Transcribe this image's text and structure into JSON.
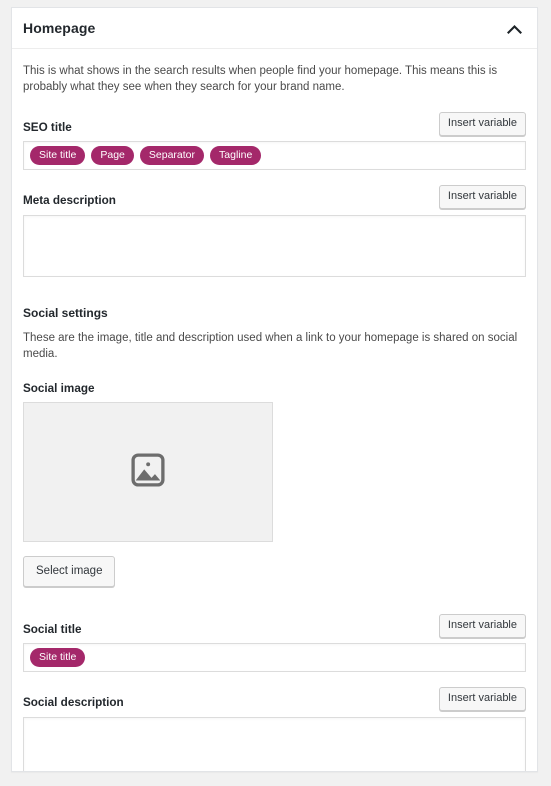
{
  "panel": {
    "title": "Homepage",
    "collapse_icon": "chevron-up-icon",
    "intro": "This is what shows in the search results when people find your homepage. This means this is probably what they see when they search for your brand name."
  },
  "seo_title": {
    "label": "SEO title",
    "insert_variable_label": "Insert variable",
    "pills": [
      {
        "label": "Site title"
      },
      {
        "label": "Page"
      },
      {
        "label": "Separator"
      },
      {
        "label": "Tagline"
      }
    ]
  },
  "meta_description": {
    "label": "Meta description",
    "insert_variable_label": "Insert variable",
    "value": "",
    "placeholder": ""
  },
  "social_settings": {
    "heading": "Social settings",
    "description": "These are the image, title and description used when a link to your homepage is shared on social media."
  },
  "social_image": {
    "label": "Social image",
    "placeholder_icon": "image-placeholder-icon",
    "select_button_label": "Select image"
  },
  "social_title": {
    "label": "Social title",
    "insert_variable_label": "Insert variable",
    "pills": [
      {
        "label": "Site title"
      }
    ]
  },
  "social_description": {
    "label": "Social description",
    "insert_variable_label": "Insert variable",
    "value": "",
    "placeholder": ""
  },
  "colors": {
    "accent": "#a4286a",
    "panel_background": "#ffffff",
    "page_background": "#f1f1f1",
    "text": "#23282d",
    "muted_text": "#4a4a4a",
    "border": "#dcdcdc",
    "dropzone_background": "#f1f1f1"
  }
}
